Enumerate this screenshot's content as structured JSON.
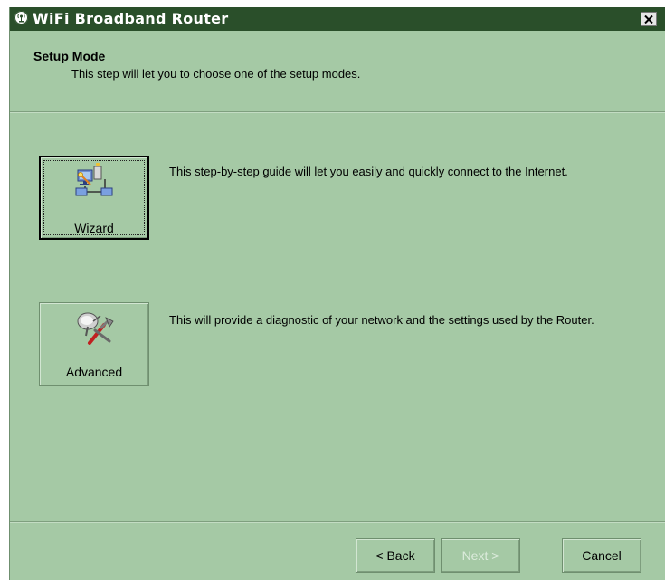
{
  "window": {
    "title": "WiFi Broadband Router",
    "icon": "router-antenna-icon",
    "close_icon": "close-x-icon"
  },
  "header": {
    "title": "Setup Mode",
    "subtitle": "This step will let you to choose one of the setup modes."
  },
  "options": [
    {
      "label": "Wizard",
      "icon": "network-wizard-icon",
      "description": "This step-by-step guide will let you easily and quickly connect to the Internet.",
      "focused": true
    },
    {
      "label": "Advanced",
      "icon": "satellite-tools-icon",
      "description": "This will provide a diagnostic of your network and the settings used by the Router.",
      "focused": false
    }
  ],
  "footer": {
    "back_label": "< Back",
    "next_label": "Next >",
    "cancel_label": "Cancel",
    "next_enabled": false
  },
  "colors": {
    "window_bg": "#a5c9a5",
    "titlebar_bg": "#2a4f2a",
    "disabled_text": "#dcebdc"
  }
}
